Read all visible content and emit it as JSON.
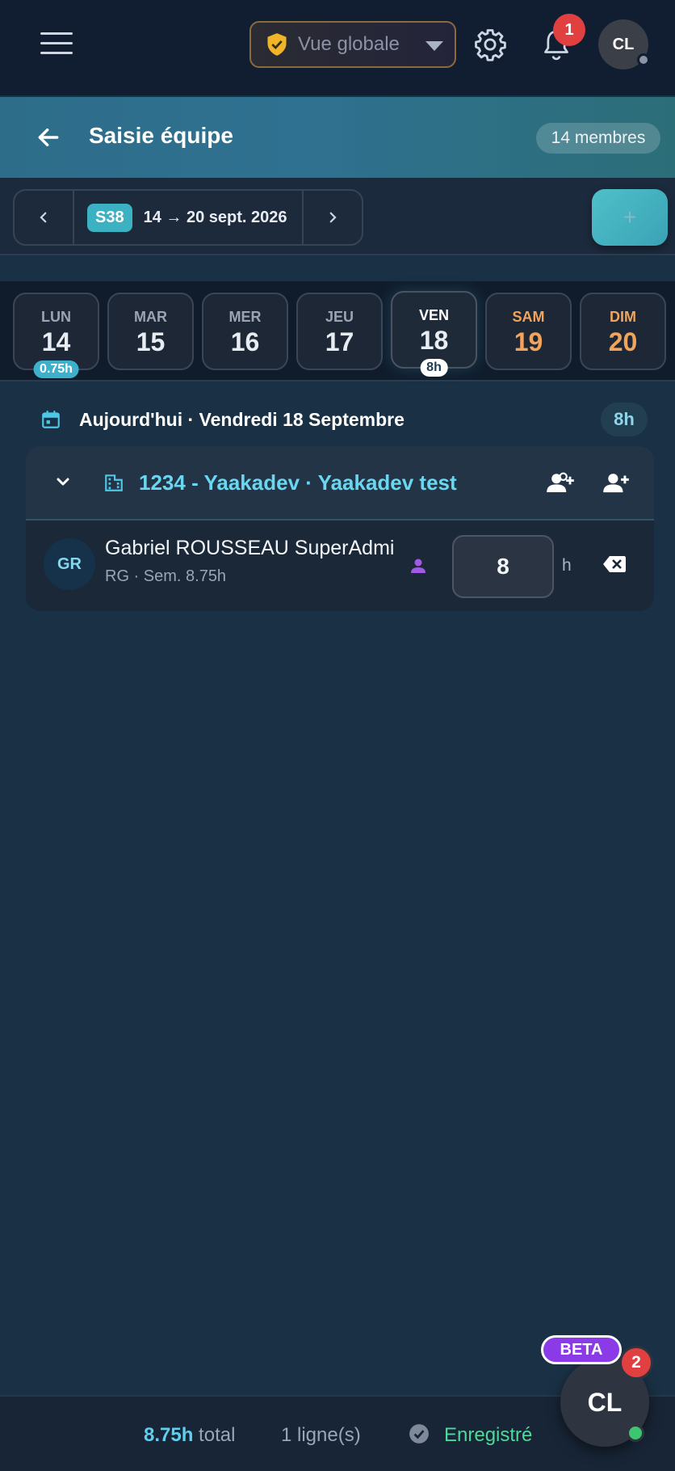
{
  "topbar": {
    "view_selector": "Vue globale",
    "notifications_count": "1",
    "user_initials": "CL"
  },
  "header": {
    "title": "Saisie équipe",
    "members": "14 membres"
  },
  "week": {
    "chip": "S38",
    "range": "14 → 20 sept. 2026",
    "add_label": "+"
  },
  "days": [
    {
      "name": "LUN",
      "num": "14",
      "hours": "0.75h"
    },
    {
      "name": "MAR",
      "num": "15",
      "hours": ""
    },
    {
      "name": "MER",
      "num": "16",
      "hours": ""
    },
    {
      "name": "JEU",
      "num": "17",
      "hours": ""
    },
    {
      "name": "VEN",
      "num": "18",
      "hours": "8h"
    },
    {
      "name": "SAM",
      "num": "19",
      "hours": ""
    },
    {
      "name": "DIM",
      "num": "20",
      "hours": ""
    }
  ],
  "today": {
    "label": "Aujourd'hui · Vendredi 18 Septembre",
    "hours": "8h"
  },
  "group": {
    "name": "1234 - Yaakadev · Yaakadev test",
    "members": [
      {
        "initials": "GR",
        "name": "Gabriel ROUSSEAU SuperAdmin",
        "sub": "RG · Sem. 8.75h",
        "hours": "8",
        "unit": "h"
      }
    ]
  },
  "footer": {
    "total_value": "8.75h",
    "total_label": "total",
    "lines": "1 ligne(s)",
    "status": "Enregistré"
  },
  "fab": {
    "initials": "CL",
    "beta": "BETA",
    "badge": "2"
  },
  "colors": {
    "accent": "#3bb1c2",
    "weekend": "#f0a45c",
    "saved": "#4fd89a",
    "badge": "#e0403f",
    "beta": "#8a3ae6"
  }
}
